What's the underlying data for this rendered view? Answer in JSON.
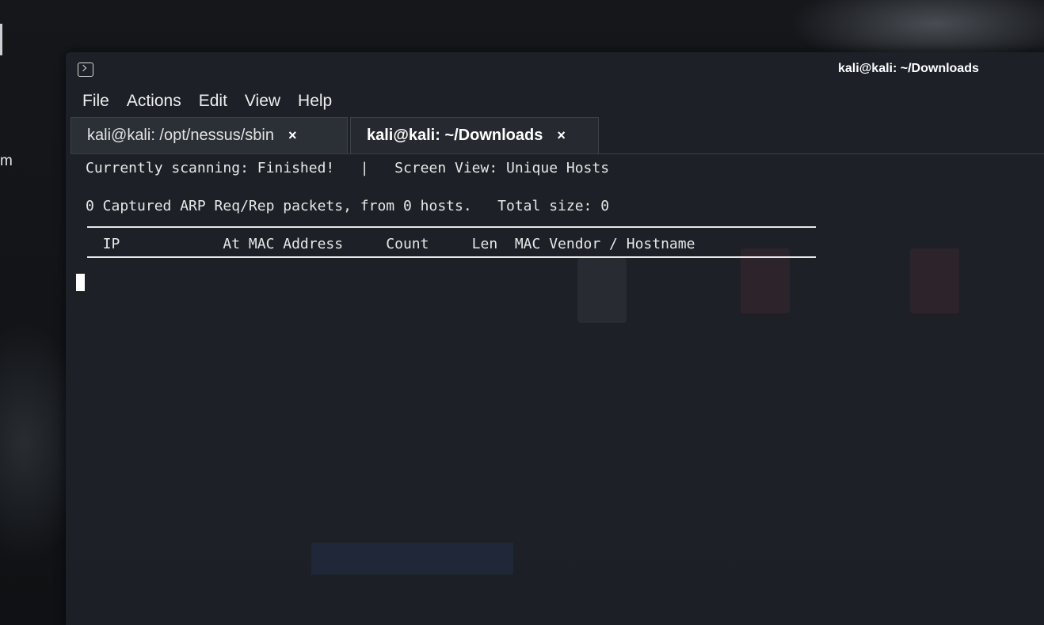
{
  "desktop": {
    "partial_label": "m"
  },
  "window": {
    "title": "kali@kali: ~/Downloads",
    "icon": "terminal-icon"
  },
  "menu": [
    "File",
    "Actions",
    "Edit",
    "View",
    "Help"
  ],
  "tabs": [
    {
      "label": "kali@kali: /opt/nessus/sbin",
      "close": "×",
      "active": false
    },
    {
      "label": "kali@kali: ~/Downloads",
      "close": "×",
      "active": true
    }
  ],
  "console": {
    "status_line": "Currently scanning: Finished!   |   Screen View: Unique Hosts",
    "summary_line": "0 Captured ARP Req/Rep packets, from 0 hosts.   Total size: 0",
    "header_line": "  IP            At MAC Address     Count     Len  MAC Vendor / Hostname"
  },
  "colors": {
    "background": "#121417",
    "terminal_bg": "#1e2127",
    "text": "#e8e8e8"
  }
}
